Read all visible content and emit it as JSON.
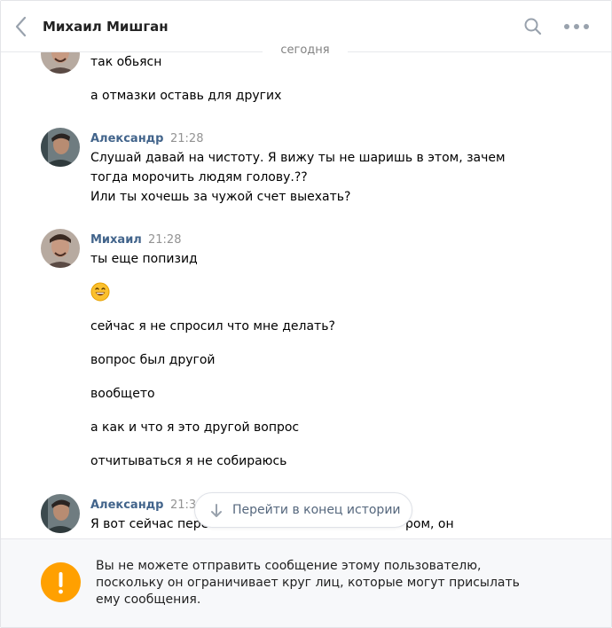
{
  "header": {
    "title": "Михаил Мишган",
    "back_icon": "chevron-left-icon",
    "search_icon": "search-icon",
    "more_icon": "more-dots-icon"
  },
  "date_separator": "сегодня",
  "messages": [
    {
      "author": "",
      "time": "",
      "lines": [
        "так обьясн"
      ]
    },
    {
      "author": "",
      "time": "",
      "lines": [
        "а отмазки оставь для других"
      ]
    },
    {
      "author": "Александр",
      "time": "21:28",
      "lines": [
        "Слушай давай на чистоту. Я вижу ты не шаришь в этом, зачем",
        "тогда морочить людям голову.??",
        "Или ты хочешь за чужой счет выехать?"
      ]
    },
    {
      "author": "Михаил",
      "time": "21:28",
      "lines": [
        "ты еще попизид"
      ]
    },
    {
      "author": "",
      "time": "",
      "lines": [
        "😄"
      ]
    },
    {
      "author": "",
      "time": "",
      "lines": [
        "сейчас я не спросил что мне делать?"
      ]
    },
    {
      "author": "",
      "time": "",
      "lines": [
        "вопрос был другой"
      ]
    },
    {
      "author": "",
      "time": "",
      "lines": [
        "вообщето"
      ]
    },
    {
      "author": "",
      "time": "",
      "lines": [
        "а как и что я это другой вопрос"
      ]
    },
    {
      "author": "",
      "time": "",
      "lines": [
        "отчитываться я не собираюсь"
      ]
    },
    {
      "author": "Александр",
      "time": "21:3",
      "lines": [
        "Я вот сейчас пере",
        "ром, он"
      ]
    }
  ],
  "scroll_button": {
    "label": "Перейти в конец истории",
    "icon": "arrow-down-icon"
  },
  "blocked_notice": {
    "icon": "exclamation-icon",
    "lines": [
      "Вы не можете отправить сообщение этому пользователю,",
      "поскольку он ограничивает круг лиц, которые могут присылать",
      "ему сообщения."
    ]
  },
  "colors": {
    "author": "#42648b",
    "warning": "#ffa000",
    "icon": "#99a2ad"
  }
}
